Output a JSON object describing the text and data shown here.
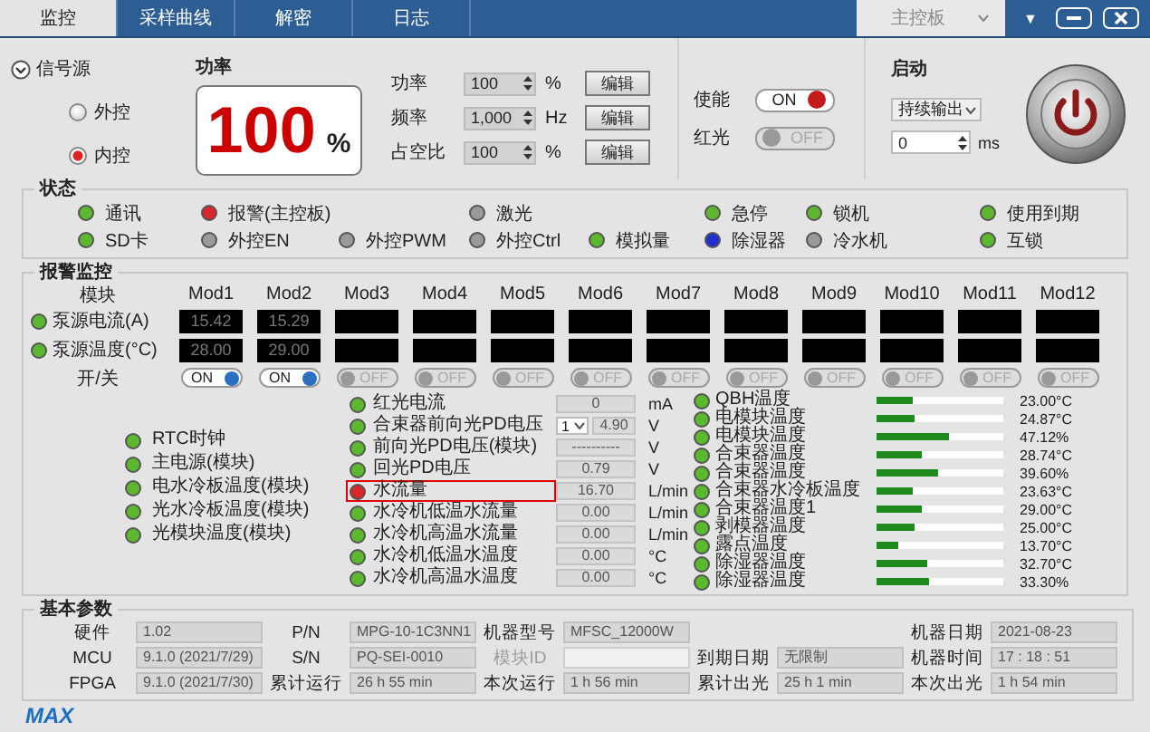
{
  "tabs": [
    {
      "label": "监控",
      "selected": true
    },
    {
      "label": "采样曲线",
      "selected": false
    },
    {
      "label": "解密",
      "selected": false
    },
    {
      "label": "日志",
      "selected": false
    }
  ],
  "board_select": {
    "value": "主控板"
  },
  "menu_glyph": "▼",
  "signal_source": {
    "title": "信号源",
    "expanded": true,
    "options": [
      {
        "label": "外控",
        "selected": false
      },
      {
        "label": "内控",
        "selected": true
      }
    ]
  },
  "power": {
    "title": "功率",
    "value": "100",
    "unit": "%"
  },
  "params": [
    {
      "label": "功率",
      "value": "100",
      "unit": "%",
      "button": "编辑"
    },
    {
      "label": "频率",
      "value": "1,000",
      "unit": "Hz",
      "button": "编辑"
    },
    {
      "label": "占空比",
      "value": "100",
      "unit": "%",
      "button": "编辑"
    }
  ],
  "switches": [
    {
      "label": "使能",
      "text": "ON",
      "on": true
    },
    {
      "label": "红光",
      "text": "OFF",
      "on": false
    }
  ],
  "start": {
    "title": "启动",
    "mode": "持续输出",
    "delay": "0",
    "delay_unit": "ms"
  },
  "status": {
    "title": "状态",
    "rows": [
      [
        {
          "label": "通讯",
          "color": "#5cb82e"
        },
        {
          "label": "报警(主控板)",
          "color": "#d9262b"
        },
        "",
        {
          "label": "激光",
          "color": "#9a9a9a"
        },
        "",
        {
          "label": "急停",
          "color": "#5cb82e"
        },
        {
          "label": "锁机",
          "color": "#5cb82e"
        },
        {
          "label": "使用到期",
          "color": "#5cb82e"
        }
      ],
      [
        {
          "label": "SD卡",
          "color": "#5cb82e"
        },
        {
          "label": "外控EN",
          "color": "#9a9a9a"
        },
        {
          "label": "外控PWM",
          "color": "#9a9a9a"
        },
        {
          "label": "外控Ctrl",
          "color": "#9a9a9a"
        },
        {
          "label": "模拟量",
          "color": "#5cb82e"
        },
        {
          "label": "除湿器",
          "color": "#2030d0"
        },
        {
          "label": "冷水机",
          "color": "#9a9a9a"
        },
        {
          "label": "互锁",
          "color": "#5cb82e"
        }
      ]
    ]
  },
  "alarm": {
    "title": "报警监控",
    "header_label": "模块",
    "row_labels": [
      {
        "label": "泵源电流(A)",
        "color": "#5cb82e"
      },
      {
        "label": "泵源温度(°C)",
        "color": "#5cb82e"
      }
    ],
    "switch_label": "开/关",
    "modules": [
      {
        "name": "Mod1",
        "current": "15.42",
        "temperature": "28.00",
        "on": true,
        "switch_text": "ON"
      },
      {
        "name": "Mod2",
        "current": "15.29",
        "temperature": "29.00",
        "on": true,
        "switch_text": "ON"
      },
      {
        "name": "Mod3",
        "on": false,
        "switch_text": "OFF"
      },
      {
        "name": "Mod4",
        "on": false,
        "switch_text": "OFF"
      },
      {
        "name": "Mod5",
        "on": false,
        "switch_text": "OFF"
      },
      {
        "name": "Mod6",
        "on": false,
        "switch_text": "OFF"
      },
      {
        "name": "Mod7",
        "on": false,
        "switch_text": "OFF"
      },
      {
        "name": "Mod8",
        "on": false,
        "switch_text": "OFF"
      },
      {
        "name": "Mod9",
        "on": false,
        "switch_text": "OFF"
      },
      {
        "name": "Mod10",
        "on": false,
        "switch_text": "OFF"
      },
      {
        "name": "Mod11",
        "on": false,
        "switch_text": "OFF"
      },
      {
        "name": "Mod12",
        "on": false,
        "switch_text": "OFF"
      }
    ],
    "signals": [
      {
        "label": "RTC时钟",
        "color": "#5cb82e"
      },
      {
        "label": "主电源(模块)",
        "color": "#5cb82e"
      },
      {
        "label": "电水冷板温度(模块)",
        "color": "#5cb82e"
      },
      {
        "label": "光水冷板温度(模块)",
        "color": "#5cb82e"
      },
      {
        "label": "光模块温度(模块)",
        "color": "#5cb82e"
      }
    ],
    "sensors": [
      {
        "label": "红光电流",
        "color": "#5cb82e",
        "value": "0",
        "unit": "mA",
        "highlighted": false
      },
      {
        "label": "合束器前向光PD电压",
        "color": "#5cb82e",
        "channel": "1",
        "value": "4.90",
        "unit": "V",
        "highlighted": false
      },
      {
        "label": "前向光PD电压(模块)",
        "color": "#5cb82e",
        "value": "----------",
        "unit": "V",
        "highlighted": false
      },
      {
        "label": "回光PD电压",
        "color": "#5cb82e",
        "value": "0.79",
        "unit": "V",
        "highlighted": false
      },
      {
        "label": "水流量",
        "color": "#d9262b",
        "value": "16.70",
        "unit": "L/min",
        "highlighted": true
      },
      {
        "label": "水冷机低温水流量",
        "color": "#5cb82e",
        "value": "0.00",
        "unit": "L/min",
        "highlighted": false
      },
      {
        "label": "水冷机高温水流量",
        "color": "#5cb82e",
        "value": "0.00",
        "unit": "L/min",
        "highlighted": false
      },
      {
        "label": "水冷机低温水温度",
        "color": "#5cb82e",
        "value": "0.00",
        "unit": "°C",
        "highlighted": false
      },
      {
        "label": "水冷机高温水温度",
        "color": "#5cb82e",
        "value": "0.00",
        "unit": "°C",
        "highlighted": false
      }
    ],
    "temperatures": [
      {
        "label": "QBH温度",
        "color": "#5cb82e",
        "level": 0.28,
        "reading": "23.00°C"
      },
      {
        "label": "电模块温度",
        "color": "#5cb82e",
        "level": 0.3,
        "reading": "24.87°C"
      },
      {
        "label": "电模块温度",
        "color": "#5cb82e",
        "level": 0.57,
        "reading": "47.12%"
      },
      {
        "label": "合束器温度",
        "color": "#5cb82e",
        "level": 0.35,
        "reading": "28.74°C"
      },
      {
        "label": "合束器温度",
        "color": "#5cb82e",
        "level": 0.48,
        "reading": "39.60%"
      },
      {
        "label": "合束器水冷板温度",
        "color": "#5cb82e",
        "level": 0.29,
        "reading": "23.63°C"
      },
      {
        "label": "合束器温度1",
        "color": "#5cb82e",
        "level": 0.36,
        "reading": "29.00°C"
      },
      {
        "label": "剥模器温度",
        "color": "#5cb82e",
        "level": 0.3,
        "reading": "25.00°C"
      },
      {
        "label": "露点温度",
        "color": "#5cb82e",
        "level": 0.17,
        "reading": "13.70°C"
      },
      {
        "label": "除湿器温度",
        "color": "#5cb82e",
        "level": 0.4,
        "reading": "32.70°C"
      },
      {
        "label": "除湿器温度",
        "color": "#5cb82e",
        "level": 0.41,
        "reading": "33.30%"
      }
    ]
  },
  "basic": {
    "title": "基本参数",
    "rows": [
      [
        {
          "kind": "field",
          "label": "硬件",
          "value": "1.02"
        },
        {
          "kind": "field",
          "label": "P/N",
          "value": "MPG-10-1C3NN1"
        },
        {
          "kind": "field",
          "label": "机器型号",
          "value": "MFSC_12000W"
        },
        {
          "kind": "empty"
        },
        {
          "kind": "field",
          "label": "机器日期",
          "value": "2021-08-23"
        }
      ],
      [
        {
          "kind": "field",
          "label": "MCU",
          "value": "9.1.0 (2021/7/29)"
        },
        {
          "kind": "field",
          "label": "S/N",
          "value": "PQ-SEI-0010"
        },
        {
          "kind": "field",
          "label": "模块ID",
          "disabled": true
        },
        {
          "kind": "field",
          "label": "到期日期",
          "value": "无限制"
        },
        {
          "kind": "field",
          "label": "机器时间",
          "value": "17 : 18 : 51"
        }
      ],
      [
        {
          "kind": "field",
          "label": "FPGA",
          "value": "9.1.0 (2021/7/30)"
        },
        {
          "kind": "field",
          "label": "累计运行",
          "value": "26 h 55 min"
        },
        {
          "kind": "field",
          "label": "本次运行",
          "value": "1 h 56 min"
        },
        {
          "kind": "field",
          "label": "累计出光",
          "value": "25 h 1 min"
        },
        {
          "kind": "field",
          "label": "本次出光",
          "value": "1 h 54 min"
        }
      ]
    ]
  },
  "logo": "MAX"
}
